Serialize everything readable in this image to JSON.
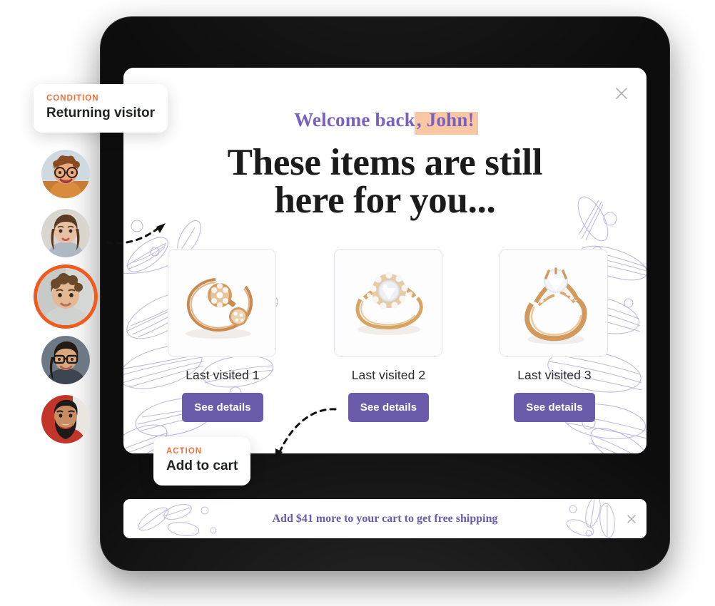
{
  "modal": {
    "close_icon": "close-icon",
    "welcome_prefix": "Welcome back",
    "welcome_highlight": ", John!",
    "headline_line1": "These items are still",
    "headline_line2": "here for you...",
    "accent_purple": "#6b5bab",
    "welcome_purple": "#7a61c0",
    "highlight_peach": "#f9c7a4",
    "products": [
      {
        "label": "Last visited 1",
        "button": "See details",
        "image": "ring-bracelet-gold-flower"
      },
      {
        "label": "Last visited 2",
        "button": "See details",
        "image": "ring-gold-halo-diamond"
      },
      {
        "label": "Last visited 3",
        "button": "See details",
        "image": "ring-gold-solitaire-twist"
      }
    ]
  },
  "shipping_bar": {
    "message": "Add $41 more to your cart to get free shipping",
    "close_icon": "close-icon"
  },
  "callouts": [
    {
      "kicker": "CONDITION",
      "title": "Returning visitor",
      "accent": "#ef6f3c"
    },
    {
      "kicker": "ACTION",
      "title": "Add to cart",
      "accent": "#ef6f3c"
    }
  ],
  "avatars": [
    {
      "name": "avatar-1",
      "selected": false
    },
    {
      "name": "avatar-2",
      "selected": false
    },
    {
      "name": "avatar-3",
      "selected": true
    },
    {
      "name": "avatar-4",
      "selected": false
    },
    {
      "name": "avatar-5",
      "selected": false
    }
  ],
  "avatar_ring_color": "#ef5a1e",
  "device": {
    "frame_color": "#0d0d0d"
  }
}
